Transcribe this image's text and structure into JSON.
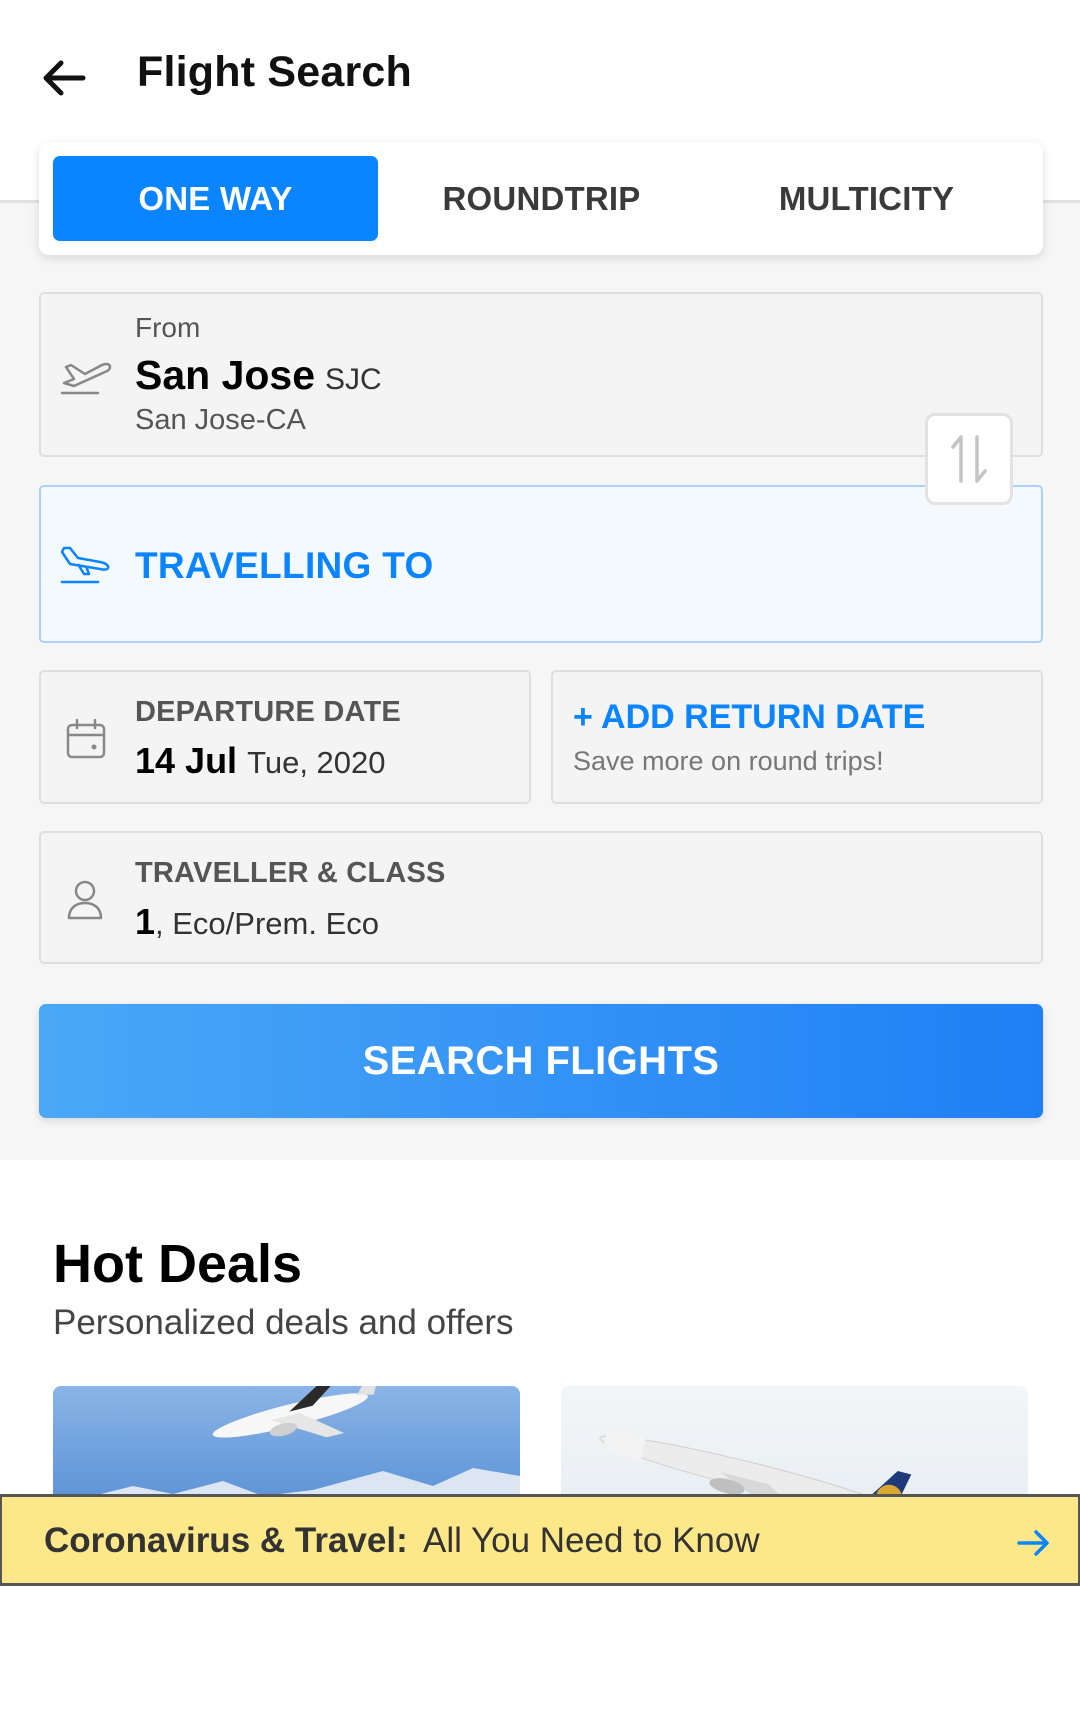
{
  "header": {
    "title": "Flight Search",
    "back_icon": "arrow-left-icon"
  },
  "trip_tabs": [
    {
      "label": "ONE WAY",
      "active": true
    },
    {
      "label": "ROUNDTRIP",
      "active": false
    },
    {
      "label": "MULTICITY",
      "active": false
    }
  ],
  "from": {
    "label": "From",
    "city": "San Jose",
    "code": "SJC",
    "sub": "San Jose-CA",
    "icon": "takeoff-icon"
  },
  "swap_icon": "swap-vertical-icon",
  "to": {
    "placeholder": "TRAVELLING TO",
    "icon": "landing-icon"
  },
  "departure": {
    "label": "DEPARTURE DATE",
    "date": "14 Jul",
    "day": "Tue, 2020",
    "icon": "calendar-icon"
  },
  "return": {
    "label": "+ ADD RETURN DATE",
    "sub": "Save more on round trips!"
  },
  "traveller": {
    "label": "TRAVELLER & CLASS",
    "count": "1",
    "class": ", Eco/Prem. Eco",
    "icon": "person-icon"
  },
  "search_button": "SEARCH FLIGHTS",
  "deals": {
    "title": "Hot Deals",
    "subtitle": "Personalized deals and offers"
  },
  "covid_banner": {
    "strong": "Coronavirus & Travel:",
    "rest": "All You Need to Know",
    "icon": "arrow-right-icon"
  },
  "colors": {
    "accent": "#0a84ff",
    "banner": "#fde889",
    "field_bg": "#f4f4f4"
  }
}
